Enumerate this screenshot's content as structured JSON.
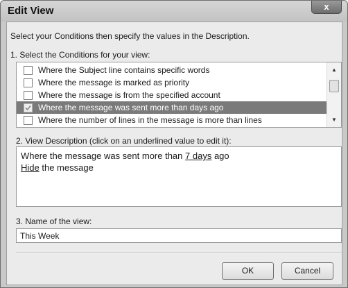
{
  "window": {
    "title": "Edit View",
    "close_glyph": "x"
  },
  "intro_text": "Select your Conditions then specify the values in the Description.",
  "conditions": {
    "label": "1. Select the Conditions for your view:",
    "items": [
      {
        "label": "Where the Subject line contains specific words",
        "checked": false,
        "selected": false
      },
      {
        "label": "Where the message is marked as priority",
        "checked": false,
        "selected": false
      },
      {
        "label": "Where the message is from the specified account",
        "checked": false,
        "selected": false
      },
      {
        "label": "Where the message was sent more than days ago",
        "checked": true,
        "selected": true
      },
      {
        "label": "Where the number of lines in the message is more than lines",
        "checked": false,
        "selected": false
      }
    ],
    "scroll_up_glyph": "▲",
    "scroll_down_glyph": "▼"
  },
  "description": {
    "label": "2. View Description (click on an underlined value to edit it):",
    "line1_prefix": "Where the message was sent more than ",
    "line1_link": "7 days",
    "line1_suffix": " ago",
    "line2_link": "Hide",
    "line2_suffix": " the message"
  },
  "name": {
    "label": "3. Name of the view:",
    "value": "This Week"
  },
  "buttons": {
    "ok": "OK",
    "cancel": "Cancel"
  },
  "colors": {
    "selection": "#7a7a7a",
    "client_bg": "#ebebeb",
    "frame": "#c9c9c9"
  }
}
